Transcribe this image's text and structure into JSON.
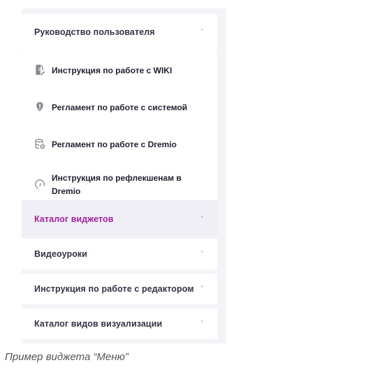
{
  "menu": {
    "sections": [
      {
        "title": "Руководство пользователя",
        "chevron": "˄",
        "expanded": true
      },
      {
        "title": "Каталог виджетов",
        "chevron": "˅",
        "active": true
      },
      {
        "title": "Видеоуроки",
        "chevron": "˅"
      },
      {
        "title": "Инструкция по работе с редактором",
        "chevron": "˅"
      },
      {
        "title": "Каталог видов визуализации",
        "chevron": "˅"
      }
    ],
    "submenu_items": [
      {
        "label": "Инструкция по работе с WIKI",
        "icon": "document-edit-icon"
      },
      {
        "label": "Регламент по работе с системой",
        "icon": "shield-alert-icon"
      },
      {
        "label": "Регламент по работе с Dremio",
        "icon": "database-settings-icon"
      },
      {
        "label": "Инструкция по рефлекшенам в Dremio",
        "icon": "speedometer-icon"
      }
    ]
  },
  "caption": "Пример виджета “Меню”",
  "colors": {
    "active": "#a4219f",
    "text": "#333344",
    "panel_bg": "#f4f4f8",
    "icon": "#8a8a94"
  }
}
